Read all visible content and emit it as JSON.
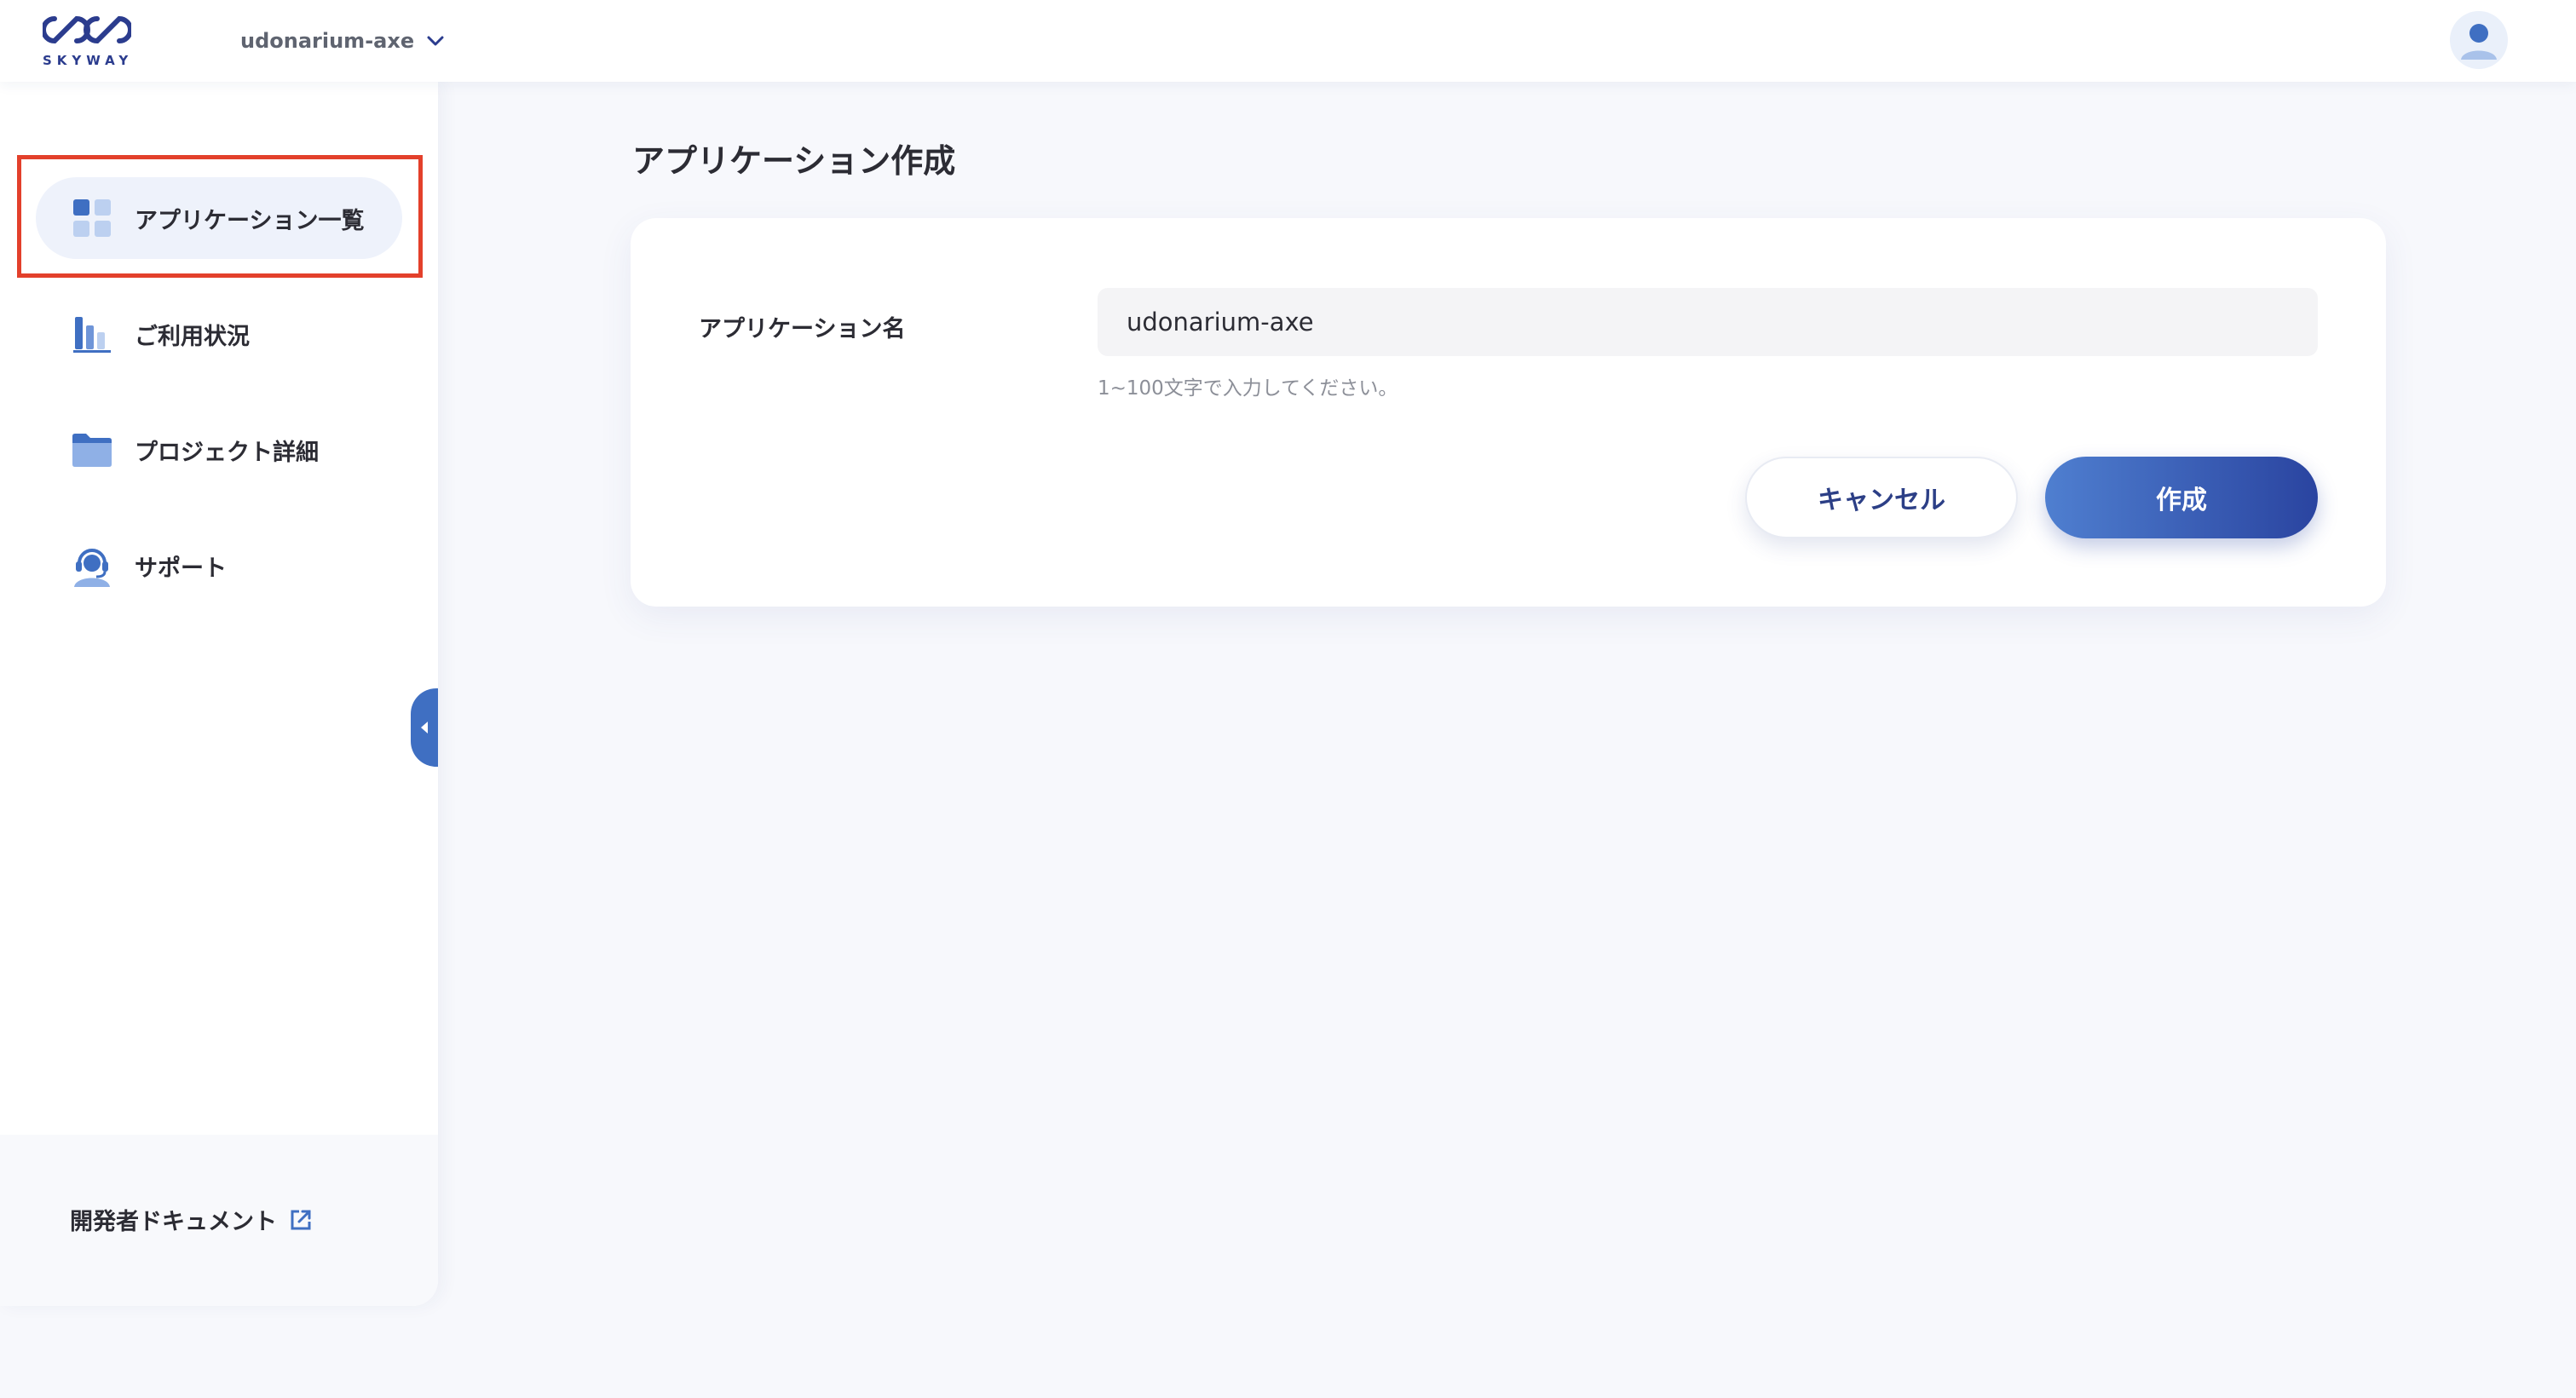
{
  "header": {
    "logo_text": "SKYWAY",
    "project_name": "udonarium-axe"
  },
  "sidebar": {
    "items": [
      {
        "label": "アプリケーション一覧",
        "icon": "grid-icon",
        "active": true
      },
      {
        "label": "ご利用状況",
        "icon": "bar-chart-icon",
        "active": false
      },
      {
        "label": "プロジェクト詳細",
        "icon": "folder-icon",
        "active": false
      },
      {
        "label": "サポート",
        "icon": "headset-icon",
        "active": false
      }
    ],
    "footer_link": "開発者ドキュメント"
  },
  "main": {
    "title": "アプリケーション作成",
    "form": {
      "name_label": "アプリケーション名",
      "name_value": "udonarium-axe",
      "help_text": "1~100文字で入力してください。",
      "cancel_label": "キャンセル",
      "create_label": "作成"
    }
  },
  "colors": {
    "brand": "#2b3c8e",
    "accent": "#3f6fc2",
    "highlight": "#e3402b",
    "active_bg": "#eef2fb"
  }
}
